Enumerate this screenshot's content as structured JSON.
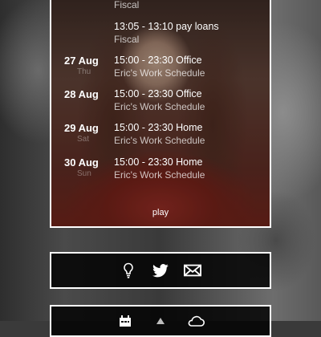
{
  "schedule": {
    "events": [
      {
        "date": "",
        "date_sub": "",
        "title": "",
        "subtitle": "Fiscal"
      },
      {
        "date": "",
        "date_sub": "",
        "title": "13:05 - 13:10 pay loans",
        "subtitle": "Fiscal"
      },
      {
        "date": "27 Aug",
        "date_sub": "Thu",
        "title": "15:00 - 23:30 Office",
        "subtitle": "Eric's Work Schedule"
      },
      {
        "date": "28 Aug",
        "date_sub": "",
        "title": "15:00 - 23:30 Office",
        "subtitle": "Eric's Work Schedule"
      },
      {
        "date": "29 Aug",
        "date_sub": "Sat",
        "title": "15:00 - 23:30 Home",
        "subtitle": "Eric's Work Schedule"
      },
      {
        "date": "30 Aug",
        "date_sub": "Sun",
        "title": "15:00 - 23:30 Home",
        "subtitle": "Eric's Work Schedule"
      }
    ],
    "play_label": "play"
  },
  "social_icons": [
    "lightbulb-icon",
    "twitter-icon",
    "mail-icon"
  ],
  "bottom_icons": [
    "calendar-icon",
    "arrow-up-icon",
    "cloud-icon"
  ],
  "colors": {
    "panel": "#000000",
    "border": "#ffffff",
    "text": "#ffffff"
  }
}
